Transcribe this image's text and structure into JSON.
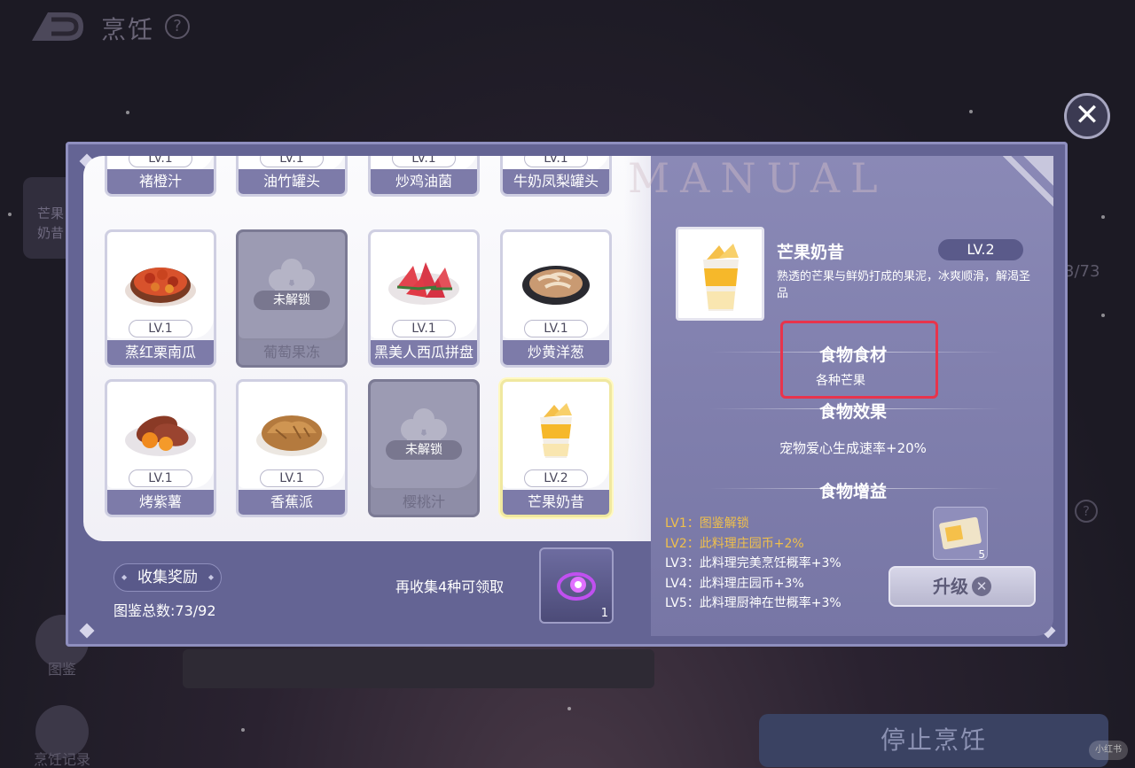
{
  "background": {
    "title": "烹饪",
    "help": "?",
    "side_card_text": [
      "芒果",
      "奶昔"
    ],
    "collection_count": "3/73",
    "side_label_1": "图鉴",
    "side_label_2": "烹饪记录",
    "stop_cooking": "停止烹饪",
    "watermark": "小红书"
  },
  "close_label": "✕",
  "grid": {
    "top_row": [
      {
        "name": "褚橙汁",
        "lv": "LV.1"
      },
      {
        "name": "油竹罐头",
        "lv": "LV.1"
      },
      {
        "name": "炒鸡油菌",
        "lv": "LV.1"
      },
      {
        "name": "牛奶凤梨罐头",
        "lv": "LV.1"
      }
    ],
    "row2": [
      {
        "name": "蒸红栗南瓜",
        "lv": "LV.1",
        "food_icon": "chestnut-pumpkin-dish"
      },
      {
        "name": "葡萄果冻",
        "locked": "未解锁"
      },
      {
        "name": "黑美人西瓜拼盘",
        "lv": "LV.1",
        "food_icon": "watermelon-platter"
      },
      {
        "name": "炒黄洋葱",
        "lv": "LV.1",
        "food_icon": "fried-onion-dish"
      }
    ],
    "row3": [
      {
        "name": "烤紫薯",
        "lv": "LV.1",
        "food_icon": "baked-sweet-potato"
      },
      {
        "name": "香蕉派",
        "lv": "LV.1",
        "food_icon": "banana-pie"
      },
      {
        "name": "樱桃汁",
        "locked": "未解锁"
      },
      {
        "name": "芒果奶昔",
        "lv": "LV.2",
        "food_icon": "mango-milkshake"
      }
    ]
  },
  "footer": {
    "reward_label": "收集奖励",
    "total": "图鉴总数:73/92",
    "hint": "再收集4种可领取",
    "reward_count": "1"
  },
  "detail": {
    "watermark": "MANUAL",
    "name": "芒果奶昔",
    "lv": "LV.2",
    "description": "熟透的芒果与鲜奶打成的果泥，冰爽顺滑，解渴圣品",
    "ingredient_title": "食物食材",
    "ingredient": "各种芒果",
    "effect_title": "食物效果",
    "effect": "宠物爱心生成速率+20%",
    "buff_title": "食物增益",
    "levels": [
      "LV1：图鉴解锁",
      "LV2：此料理庄园币+2%",
      "LV3：此料理完美烹饪概率+3%",
      "LV4：此料理庄园币+3%",
      "LV5：此料理厨神在世概率+3%"
    ],
    "upgrade_item_count": "5",
    "upgrade_label": "升级",
    "upgrade_icon": "✕"
  },
  "colors": {
    "panel": "#646494",
    "card_name_bar": "#7d7ba9",
    "level_done": "#f0c04c",
    "highlight_box": "#e8344c"
  }
}
